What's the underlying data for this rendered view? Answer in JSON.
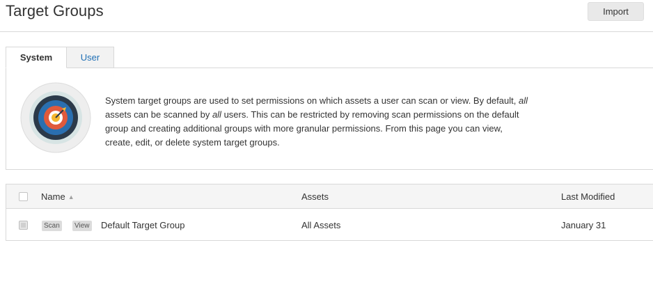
{
  "header": {
    "title": "Target Groups",
    "import_label": "Import"
  },
  "tabs": [
    {
      "label": "System",
      "active": true
    },
    {
      "label": "User",
      "active": false
    }
  ],
  "info": {
    "icon": "target-icon",
    "text_part1": "System target groups are used to set permissions on which assets a user can scan or view. By default, ",
    "em1": "all",
    "text_part2": " assets can be scanned by ",
    "em2": "all",
    "text_part3": " users. This can be restricted by removing scan permissions on the default group and creating additional groups with more granular permissions. From this page you can view, create, edit, or delete system target groups."
  },
  "table": {
    "columns": {
      "name": "Name",
      "assets": "Assets",
      "last_modified": "Last Modified"
    },
    "sort_icon": "sort-ascending-icon",
    "rows": [
      {
        "scan_label": "Scan",
        "view_label": "View",
        "name": "Default Target Group",
        "assets": "All Assets",
        "last_modified": "January 31"
      }
    ]
  },
  "colors": {
    "link": "#1f6fb5",
    "border": "#d8d8d8",
    "header_bg": "#f5f5f5"
  }
}
